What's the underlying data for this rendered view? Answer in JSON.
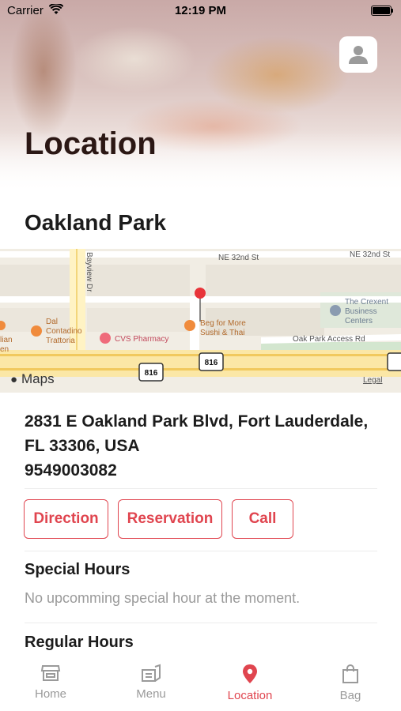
{
  "status_bar": {
    "carrier": "Carrier",
    "time": "12:19 PM"
  },
  "header": {
    "title": "Location"
  },
  "location": {
    "name": "Oakland Park",
    "address_line1": "2831 E Oakland Park Blvd, Fort Lauderdale,",
    "address_line2": "FL 33306, USA",
    "phone": "9549003082"
  },
  "map": {
    "streets": [
      "NE 32nd St",
      "NE 32nd St",
      "Bayview Dr",
      "Oak Park Access Rd"
    ],
    "places": [
      "Dal",
      "Contadino",
      "Trattoria",
      "CVS Pharmacy",
      "Beg for More",
      "Sushi & Thai",
      "The Crexent",
      "Business",
      "Centers",
      "lian",
      "en"
    ],
    "route_shields": [
      "816",
      "816"
    ],
    "brand": "Maps",
    "legal": "Legal"
  },
  "actions": {
    "direction": "Direction",
    "reservation": "Reservation",
    "call": "Call"
  },
  "special_hours": {
    "title": "Special Hours",
    "message": "No upcomming special hour at the moment."
  },
  "regular_hours": {
    "title": "Regular Hours"
  },
  "tabs": [
    {
      "label": "Home",
      "icon": "store-icon",
      "active": false
    },
    {
      "label": "Menu",
      "icon": "menu-icon",
      "active": false
    },
    {
      "label": "Location",
      "icon": "location-pin-icon",
      "active": true
    },
    {
      "label": "Bag",
      "icon": "bag-icon",
      "active": false
    }
  ],
  "colors": {
    "accent": "#e0454f",
    "title": "#2b1714",
    "muted": "#9a9a9a"
  }
}
